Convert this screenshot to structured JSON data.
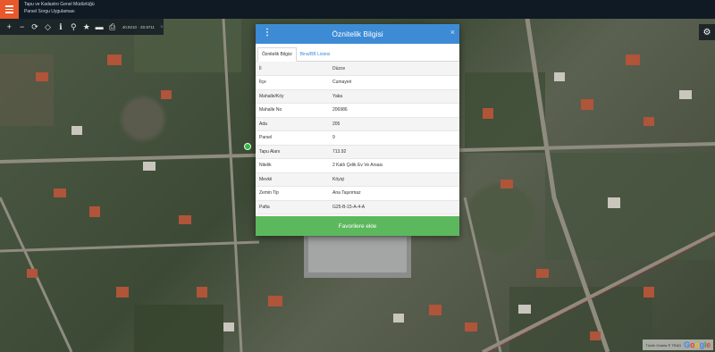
{
  "header": {
    "title": "Tapu ve Kadastro Genel Müdürlüğü",
    "subtitle": "Parsel Sorgu Uygulaması",
    "accent": "#e8582b"
  },
  "toolbar": {
    "coords": "40.8210 · 30.9711",
    "extra": "☆",
    "icons": [
      "plus-icon",
      "minus-icon",
      "refresh-icon",
      "locate-icon",
      "info-icon",
      "pin-icon",
      "star-icon",
      "measure-icon",
      "print-icon"
    ]
  },
  "modal": {
    "title": "Öznitelik Bilgisi",
    "close": "×",
    "kebab": "⋮",
    "tabs": [
      {
        "label": "Öznitelik Bilgisi",
        "active": true
      },
      {
        "label": "Bina/BB Listesi",
        "active": false
      }
    ],
    "rows": [
      {
        "key": "İl",
        "value": "Düzce"
      },
      {
        "key": "İlçe",
        "value": "Cumayeri"
      },
      {
        "key": "Mahalle/Köy",
        "value": "Yaka"
      },
      {
        "key": "Mahalle No",
        "value": "206986"
      },
      {
        "key": "Ada",
        "value": "205"
      },
      {
        "key": "Parsel",
        "value": "9"
      },
      {
        "key": "Tapu Alanı",
        "value": "713.92"
      },
      {
        "key": "Nitelik",
        "value": "2 Katlı Çelik Ev Ve Arsası"
      },
      {
        "key": "Mevkii",
        "value": "Köyiçi"
      },
      {
        "key": "Zemin Tip",
        "value": "Ana Taşınmaz"
      },
      {
        "key": "Pafta",
        "value": "G25-B-15-A-4-A"
      }
    ],
    "fav_button": "Favorilere ekle",
    "header_color": "#3d8bd4",
    "button_color": "#5cb85c"
  },
  "attribution": {
    "text": "Tüzük Orakla ® TRAD",
    "google": [
      "G",
      "o",
      "o",
      "g",
      "l",
      "e"
    ]
  }
}
